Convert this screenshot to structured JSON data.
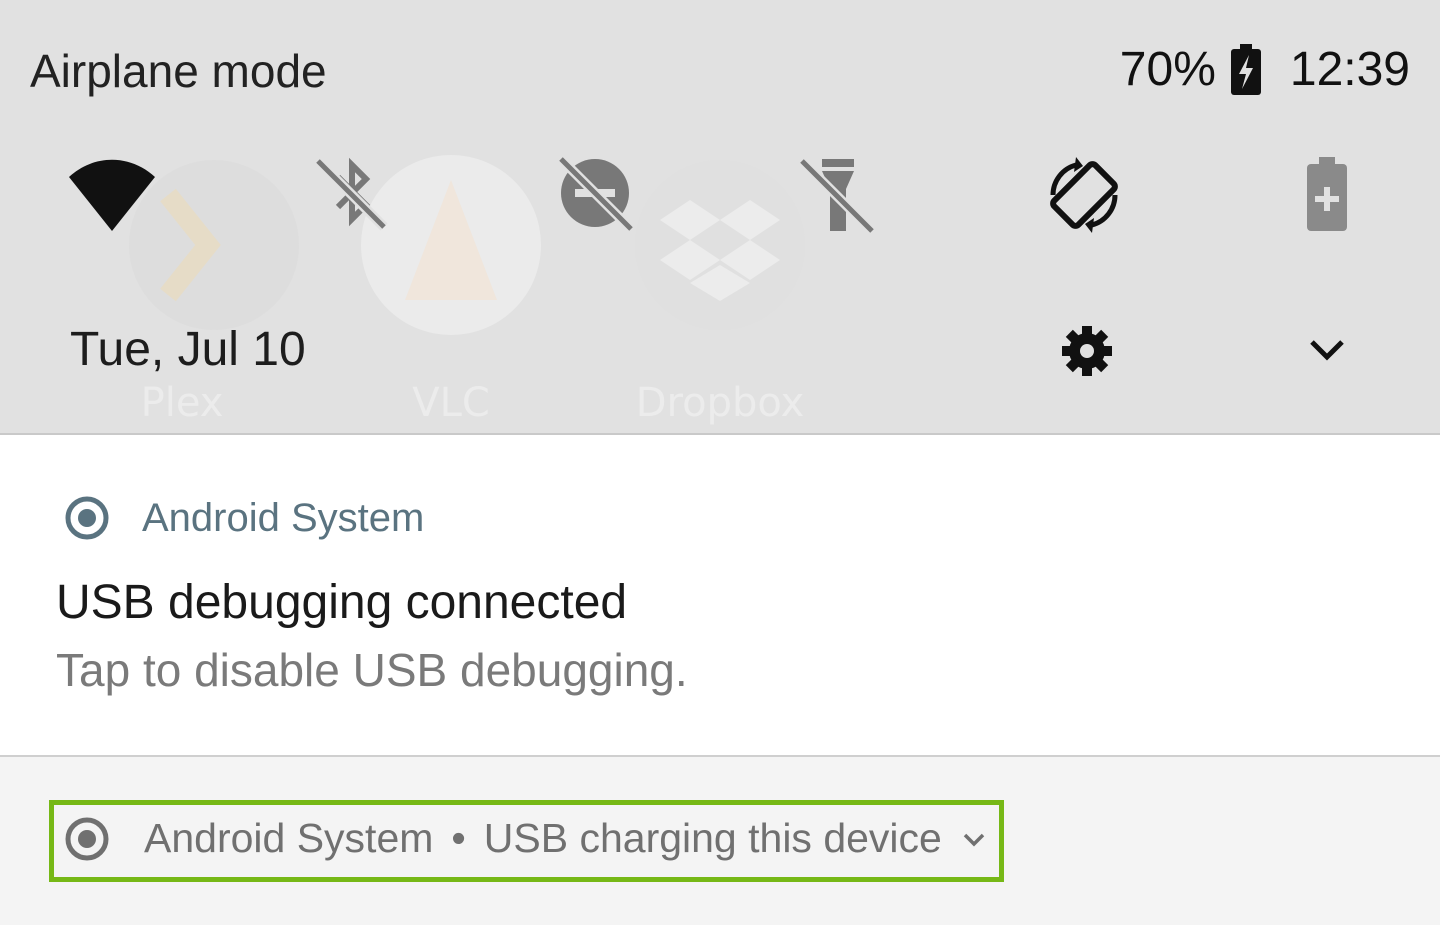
{
  "status_bar": {
    "mode_label": "Airplane mode",
    "battery_percent": "70%",
    "battery_level": 0.7,
    "time": "12:39"
  },
  "background_apps": [
    "Plex",
    "VLC",
    "Dropbox"
  ],
  "quick_settings": [
    {
      "name": "wifi",
      "icon": "wifi-icon",
      "state": "on"
    },
    {
      "name": "bluetooth",
      "icon": "bluetooth-off-icon",
      "state": "off"
    },
    {
      "name": "do-not-disturb",
      "icon": "dnd-off-icon",
      "state": "off"
    },
    {
      "name": "flashlight",
      "icon": "flashlight-off-icon",
      "state": "off"
    },
    {
      "name": "auto-rotate",
      "icon": "rotate-icon",
      "state": "on"
    },
    {
      "name": "battery-saver",
      "icon": "battery-saver-icon",
      "state": "off"
    }
  ],
  "shade_footer": {
    "date": "Tue, Jul 10",
    "settings_icon": "gear-icon",
    "expand_icon": "chevron-down-icon"
  },
  "notifications": [
    {
      "app": "Android System",
      "title": "USB debugging connected",
      "text": "Tap to disable USB debugging."
    },
    {
      "app": "Android System",
      "separator": "•",
      "summary": "USB charging this device"
    }
  ],
  "colors": {
    "shade_bg": "#e1e1e1",
    "app_name": "#5a7380",
    "highlight": "#76b816"
  }
}
